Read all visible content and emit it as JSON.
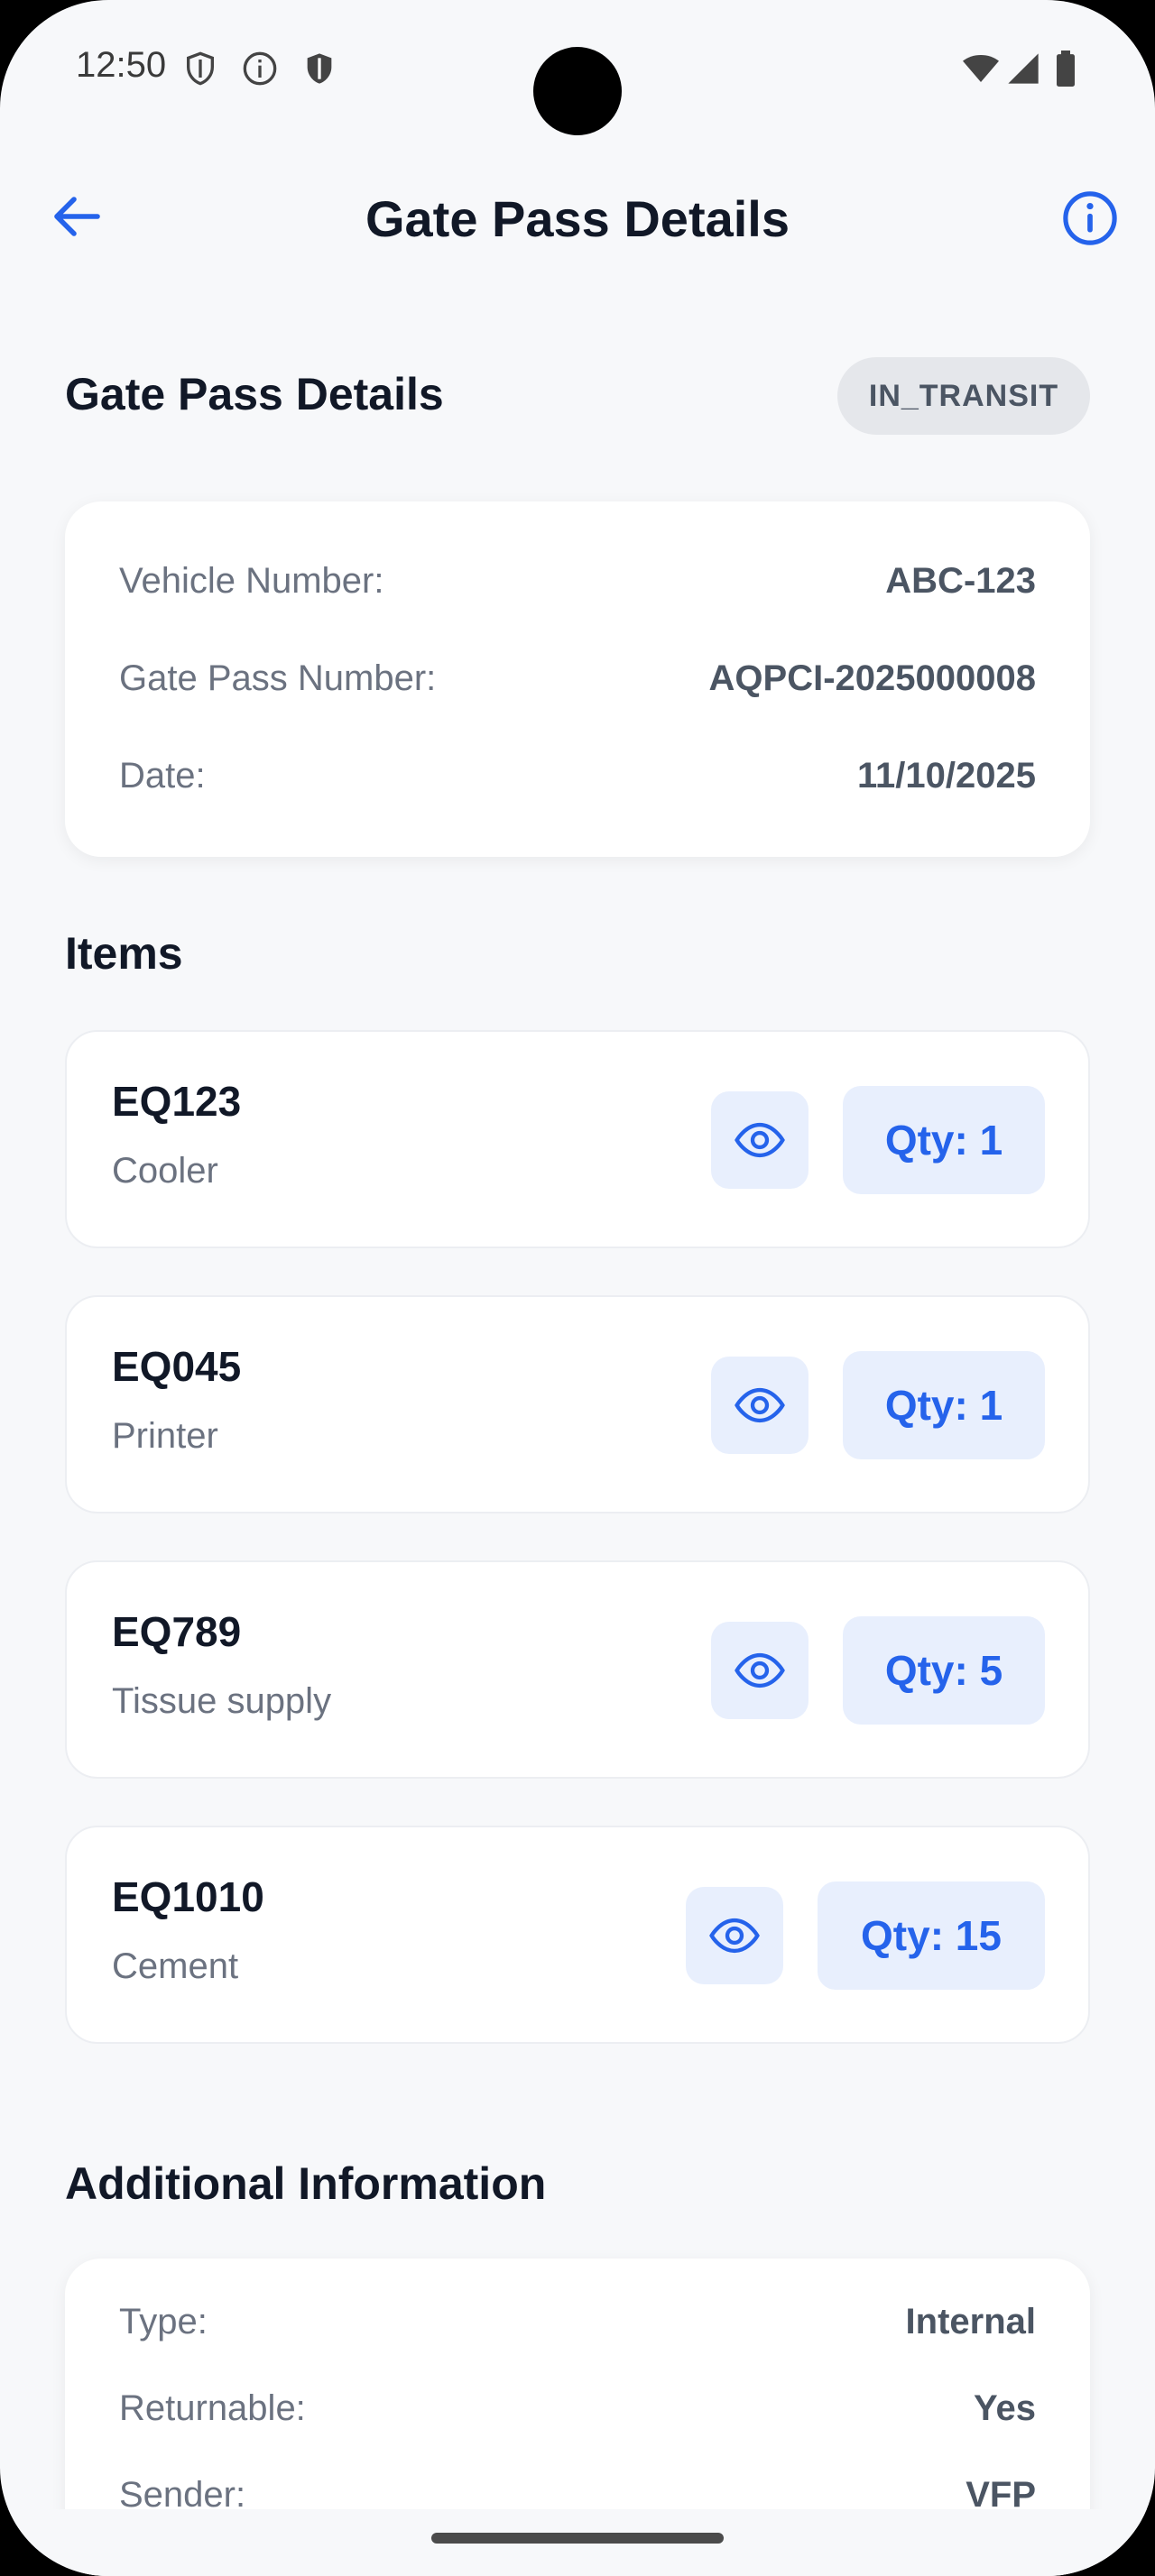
{
  "status_bar": {
    "time": "12:50"
  },
  "app_bar": {
    "title": "Gate Pass Details"
  },
  "summary": {
    "heading": "Gate Pass Details",
    "status": "IN_TRANSIT",
    "rows": [
      {
        "label": "Vehicle Number:",
        "value": "ABC-123"
      },
      {
        "label": "Gate Pass Number:",
        "value": "AQPCI-2025000008"
      },
      {
        "label": "Date:",
        "value": "11/10/2025"
      }
    ]
  },
  "items_section": {
    "heading": "Items",
    "items": [
      {
        "code": "EQ123",
        "name": "Cooler",
        "qty": "Qty: 1"
      },
      {
        "code": "EQ045",
        "name": "Printer",
        "qty": "Qty: 1"
      },
      {
        "code": "EQ789",
        "name": "Tissue supply",
        "qty": "Qty: 5"
      },
      {
        "code": "EQ1010",
        "name": "Cement",
        "qty": "Qty: 15"
      }
    ]
  },
  "additional": {
    "heading": "Additional Information",
    "rows": [
      {
        "label": "Type:",
        "value": "Internal"
      },
      {
        "label": "Returnable:",
        "value": "Yes"
      },
      {
        "label": "Sender:",
        "value": "VFP"
      }
    ]
  },
  "colors": {
    "accent": "#2563eb",
    "background": "#f7f8fa"
  }
}
